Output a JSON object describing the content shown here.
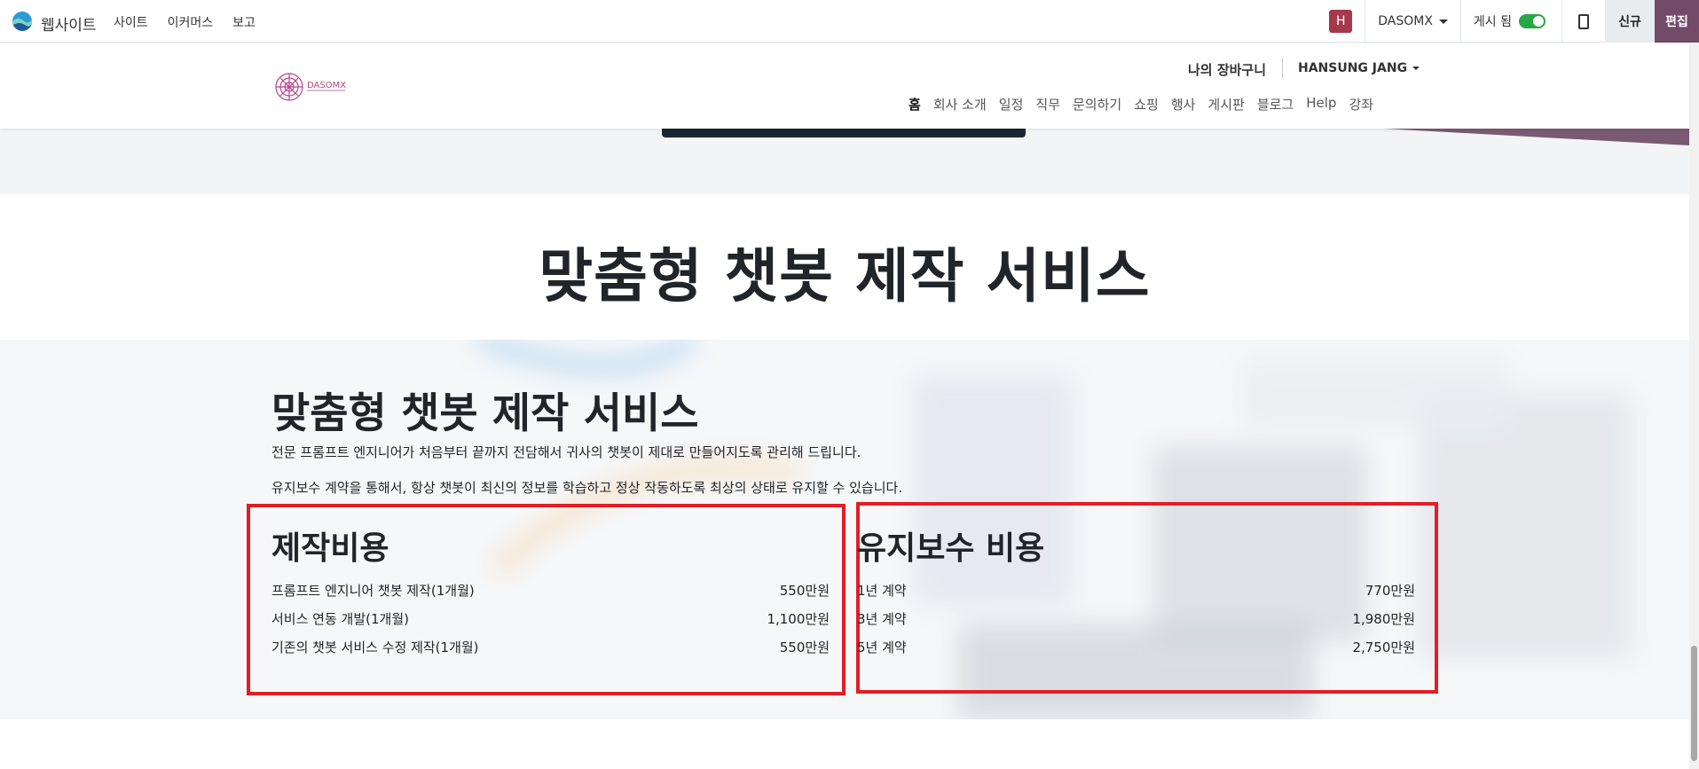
{
  "admin": {
    "app_name": "웹사이트",
    "menu": [
      "사이트",
      "이커머스",
      "보고"
    ],
    "avatar_letter": "H",
    "company": "DASOMX",
    "published_label": "게시 됨",
    "new_label": "신규",
    "edit_label": "편집"
  },
  "header": {
    "cart_label": "나의 장바구니",
    "user_name": "HANSUNG JANG",
    "nav": [
      "홈",
      "회사 소개",
      "일정",
      "직무",
      "문의하기",
      "쇼핑",
      "행사",
      "게시판",
      "블로그",
      "Help",
      "강좌"
    ]
  },
  "page": {
    "main_title": "맞춤형 챗봇 제작 서비스",
    "section_title": "맞춤형 챗봇 제작 서비스",
    "desc1": "전문 프롬프트 엔지니어가 처음부터 끝까지 전담해서 귀사의 챗봇이 제대로 만들어지도록 관리해 드립니다.",
    "desc2": "유지보수 계약을 통해서, 항상 챗봇이 최신의 정보를 학습하고 정상 작동하도록 최상의 상태로 유지할 수 있습니다.",
    "production": {
      "title": "제작비용",
      "rows": [
        {
          "label": "프롬프트 엔지니어 챗봇 제작(1개월)",
          "price": "550만원"
        },
        {
          "label": "서비스 연동 개발(1개월)",
          "price": "1,100만원"
        },
        {
          "label": "기존의 챗봇 서비스 수정 제작(1개월)",
          "price": "550만원"
        }
      ]
    },
    "maintenance": {
      "title": "유지보수 비용",
      "rows": [
        {
          "label": "1년 계약",
          "price": "770만원"
        },
        {
          "label": "3년 계약",
          "price": "1,980만원"
        },
        {
          "label": "5년 계약",
          "price": "2,750만원"
        }
      ]
    }
  },
  "colors": {
    "brand": "#714b67",
    "avatar": "#a4394b",
    "highlight_box": "#e31e24",
    "toggle_on": "#28a745"
  }
}
